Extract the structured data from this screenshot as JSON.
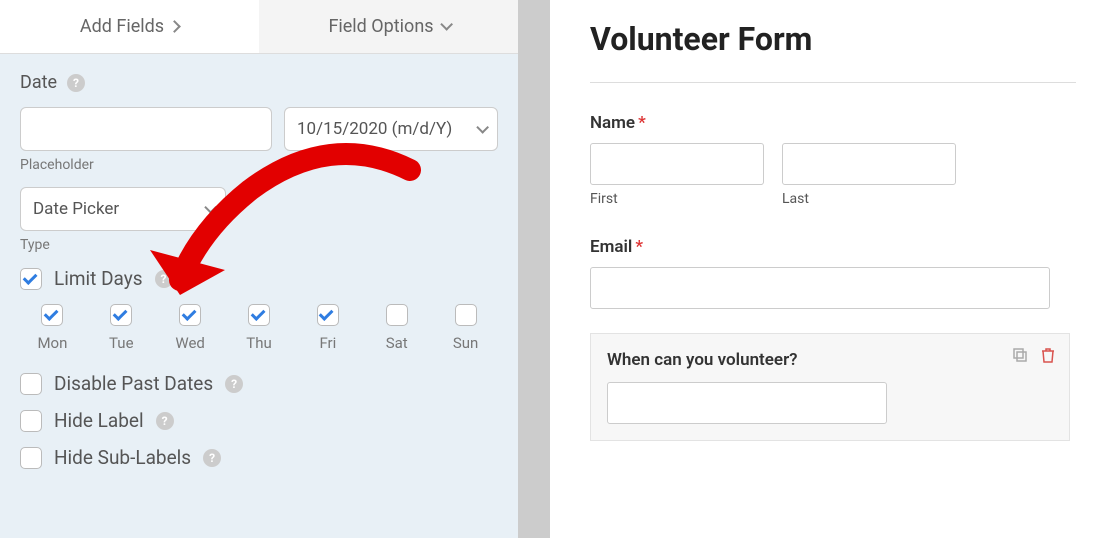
{
  "tabs": {
    "add_fields": "Add Fields",
    "field_options": "Field Options"
  },
  "panel": {
    "date_label": "Date",
    "placeholder_label": "Placeholder",
    "format_value": "10/15/2020 (m/d/Y)",
    "type_label": "Type",
    "type_value": "Date Picker",
    "limit_days_label": "Limit Days",
    "disable_past_label": "Disable Past Dates",
    "hide_label": "Hide Label",
    "hide_sublabels": "Hide Sub-Labels"
  },
  "days": [
    {
      "label": "Mon",
      "checked": true
    },
    {
      "label": "Tue",
      "checked": true
    },
    {
      "label": "Wed",
      "checked": true
    },
    {
      "label": "Thu",
      "checked": true
    },
    {
      "label": "Fri",
      "checked": true
    },
    {
      "label": "Sat",
      "checked": false
    },
    {
      "label": "Sun",
      "checked": false
    }
  ],
  "form": {
    "title": "Volunteer Form",
    "name_label": "Name",
    "first_label": "First",
    "last_label": "Last",
    "email_label": "Email",
    "volunteer_label": "When can you volunteer?"
  }
}
